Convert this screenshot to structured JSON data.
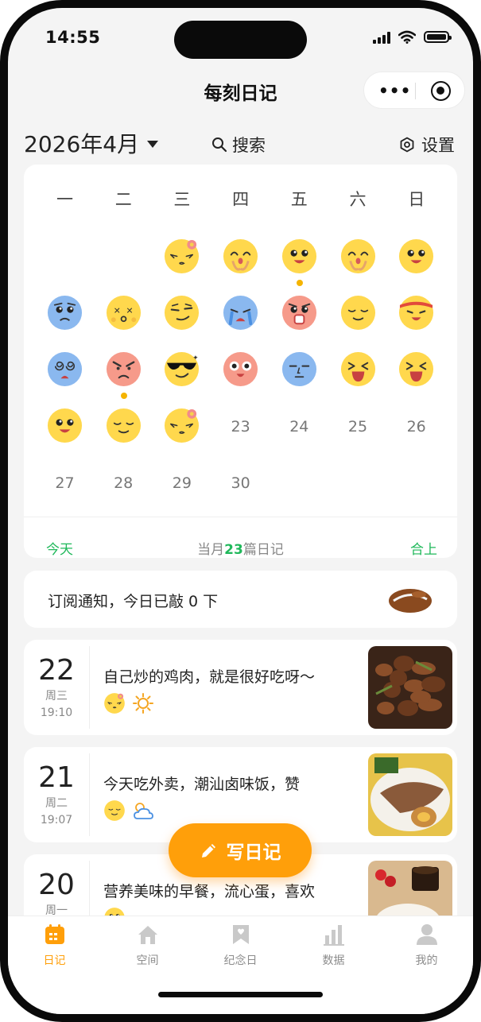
{
  "status_bar": {
    "time": "14:55"
  },
  "nav": {
    "title": "每刻日记"
  },
  "header": {
    "month": "2026年4月",
    "search": "搜索",
    "settings": "设置"
  },
  "calendar": {
    "weekdays": [
      "一",
      "二",
      "三",
      "四",
      "五",
      "六",
      "日"
    ],
    "days": [
      {
        "n": 1,
        "mood": "shy-flower-face"
      },
      {
        "n": 2,
        "mood": "praying-face"
      },
      {
        "n": 3,
        "mood": "happy-face",
        "marked": true
      },
      {
        "n": 4,
        "mood": "praying-face"
      },
      {
        "n": 5,
        "mood": "happy-face"
      },
      {
        "n": 6,
        "mood": "worried-face"
      },
      {
        "n": 7,
        "mood": "dizzy-face"
      },
      {
        "n": 8,
        "mood": "smirk-face"
      },
      {
        "n": 9,
        "mood": "crying-face"
      },
      {
        "n": 10,
        "mood": "scared-face"
      },
      {
        "n": 11,
        "mood": "content-face"
      },
      {
        "n": 12,
        "mood": "headband-face"
      },
      {
        "n": 13,
        "mood": "spiral-eyes-face"
      },
      {
        "n": 14,
        "mood": "angry-face",
        "marked": true
      },
      {
        "n": 15,
        "mood": "sunglasses-face"
      },
      {
        "n": 16,
        "mood": "surprised-face"
      },
      {
        "n": 17,
        "mood": "blank-face"
      },
      {
        "n": 18,
        "mood": "laughing-face"
      },
      {
        "n": 19,
        "mood": "laughing-face"
      },
      {
        "n": 20,
        "mood": "happy-face"
      },
      {
        "n": 21,
        "mood": "content-face"
      },
      {
        "n": 22,
        "mood": "shy-flower-face"
      },
      {
        "n": 23,
        "mood": ""
      },
      {
        "n": 24,
        "mood": ""
      },
      {
        "n": 25,
        "mood": ""
      },
      {
        "n": 26,
        "mood": ""
      },
      {
        "n": 27,
        "mood": ""
      },
      {
        "n": 28,
        "mood": ""
      },
      {
        "n": 29,
        "mood": ""
      },
      {
        "n": 30,
        "mood": ""
      }
    ],
    "today": "今天",
    "summary_prefix": "当月",
    "summary_count": "23",
    "summary_suffix": "篇日记",
    "collapse": "合上"
  },
  "subscription": {
    "text": "订阅通知，今日已敲 0 下",
    "icon": "wooden-fish-icon"
  },
  "entries": [
    {
      "day": "22",
      "weekday": "周三",
      "time": "19:10",
      "text": "自己炒的鸡肉，就是很好吃呀～",
      "mood": "shy-flower-face",
      "weather": "sunny-icon",
      "photo": "stir-fried-chicken-photo"
    },
    {
      "day": "21",
      "weekday": "周二",
      "time": "19:07",
      "text": "今天吃外卖，潮汕卤味饭，赞",
      "mood": "content-face",
      "weather": "partly-cloudy-icon",
      "photo": "braised-rice-photo"
    },
    {
      "day": "20",
      "weekday": "周一",
      "time": "",
      "text": "营养美味的早餐，流心蛋，喜欢",
      "mood": "happy-face",
      "weather": "",
      "photo": "breakfast-photo"
    }
  ],
  "fab": {
    "label": "写日记"
  },
  "tabs": [
    {
      "label": "日记",
      "icon": "calendar-icon",
      "active": true
    },
    {
      "label": "空间",
      "icon": "home-icon",
      "active": false
    },
    {
      "label": "纪念日",
      "icon": "bookmark-heart-icon",
      "active": false
    },
    {
      "label": "数据",
      "icon": "bar-chart-icon",
      "active": false
    },
    {
      "label": "我的",
      "icon": "person-icon",
      "active": false
    }
  ],
  "colors": {
    "accent": "#ff9f0a",
    "green": "#1fb85a",
    "face_yellow": "#ffd84d",
    "face_blue": "#8ab8ef",
    "face_red": "#f69a8a",
    "marker": "#f5b400"
  }
}
